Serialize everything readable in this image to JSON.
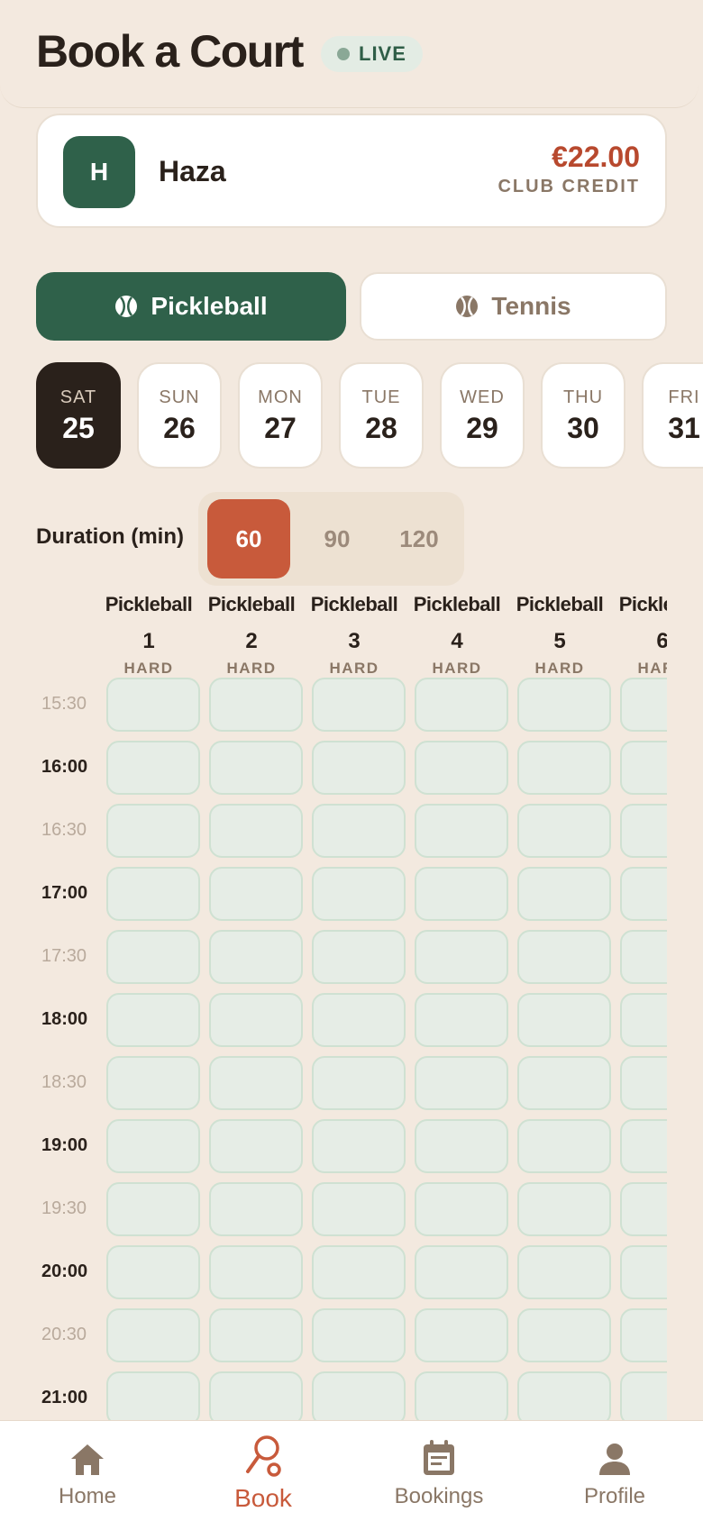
{
  "header": {
    "title": "Book a Court",
    "live_label": "LIVE"
  },
  "account": {
    "avatar_initial": "H",
    "name": "Haza",
    "credit_amount": "€22.00",
    "credit_label": "CLUB CREDIT"
  },
  "sports": [
    {
      "label": "Pickleball",
      "selected": true
    },
    {
      "label": "Tennis",
      "selected": false
    }
  ],
  "days": [
    {
      "name": "SAT",
      "num": "25",
      "selected": true
    },
    {
      "name": "SUN",
      "num": "26"
    },
    {
      "name": "MON",
      "num": "27"
    },
    {
      "name": "TUE",
      "num": "28"
    },
    {
      "name": "WED",
      "num": "29"
    },
    {
      "name": "THU",
      "num": "30"
    },
    {
      "name": "FRI",
      "num": "31"
    }
  ],
  "duration": {
    "label": "Duration (min)",
    "options": [
      "60",
      "90",
      "120"
    ],
    "selected": "60"
  },
  "courts": [
    {
      "name": "Pickleball",
      "number": "1",
      "surface": "HARD"
    },
    {
      "name": "Pickleball",
      "number": "2",
      "surface": "HARD"
    },
    {
      "name": "Pickleball",
      "number": "3",
      "surface": "HARD"
    },
    {
      "name": "Pickleball",
      "number": "4",
      "surface": "HARD"
    },
    {
      "name": "Pickleball",
      "number": "5",
      "surface": "HARD"
    },
    {
      "name": "Pickleball",
      "number": "6",
      "surface": "HARD"
    }
  ],
  "times": [
    "15:30",
    "16:00",
    "16:30",
    "17:00",
    "17:30",
    "18:00",
    "18:30",
    "19:00",
    "19:30",
    "20:00",
    "20:30",
    "21:00"
  ],
  "nav": [
    {
      "label": "Home",
      "icon": "home-icon",
      "active": false
    },
    {
      "label": "Book",
      "icon": "racket-icon",
      "active": true
    },
    {
      "label": "Bookings",
      "icon": "calendar-icon",
      "active": false
    },
    {
      "label": "Profile",
      "icon": "person-icon",
      "active": false
    }
  ],
  "colors": {
    "primary_green": "#2f614a",
    "accent_orange": "#c85a3b",
    "background": "#f3e9df",
    "slot_fill": "#e6ede6"
  }
}
